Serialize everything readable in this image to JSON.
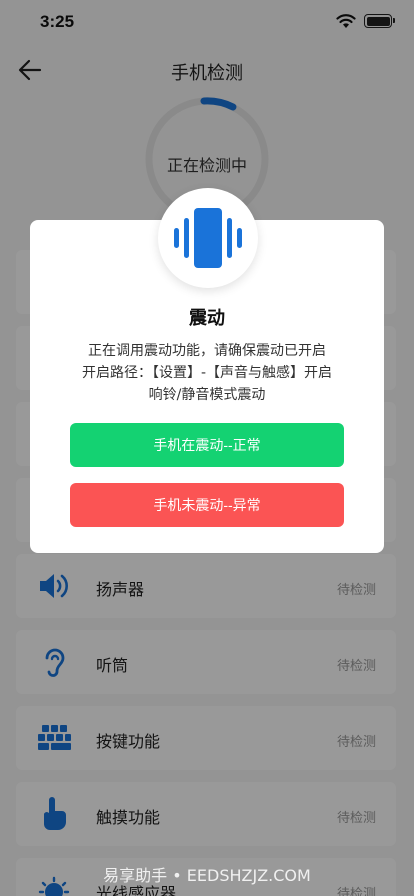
{
  "status": {
    "time": "3:25"
  },
  "nav": {
    "title": "手机检测"
  },
  "progress": {
    "label": "正在检测中"
  },
  "items": [
    {
      "label": "",
      "status": ""
    },
    {
      "label": "",
      "status": ""
    },
    {
      "label": "",
      "status": ""
    },
    {
      "label": "",
      "status": ""
    },
    {
      "label": "扬声器",
      "status": "待检测",
      "icon": "speaker-icon"
    },
    {
      "label": "听筒",
      "status": "待检测",
      "icon": "ear-icon"
    },
    {
      "label": "按键功能",
      "status": "待检测",
      "icon": "keys-icon"
    },
    {
      "label": "触摸功能",
      "status": "待检测",
      "icon": "touch-hand-icon"
    },
    {
      "label": "光线感应器",
      "status": "待检测",
      "icon": "light-sensor-icon"
    }
  ],
  "dialog": {
    "icon": "vibration-icon",
    "title": "震动",
    "line1": "正在调用震动功能，请确保震动已开启",
    "line2": "开启路径：【设置】-【声音与触感】开启",
    "line3": "响铃/静音模式震动",
    "button_normal": "手机在震动--正常",
    "button_abnormal": "手机未震动--异常"
  },
  "watermark": "易享助手 • EEDSHZJZ.COM",
  "colors": {
    "primary": "#1a73d9",
    "success": "#14d272",
    "danger": "#fb5454"
  }
}
